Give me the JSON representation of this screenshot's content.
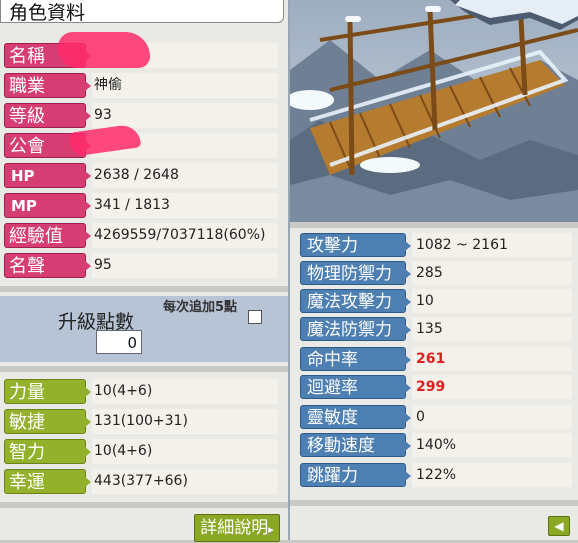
{
  "window": {
    "title": "角色資料"
  },
  "character": {
    "rows": [
      {
        "label": "名稱",
        "value": ""
      },
      {
        "label": "職業",
        "value": "神偷"
      },
      {
        "label": "等級",
        "value": "93"
      },
      {
        "label": "公會",
        "value": ""
      },
      {
        "label": "HP",
        "value": "2638 / 2648"
      },
      {
        "label": "MP",
        "value": "341 / 1813"
      },
      {
        "label": "經驗值",
        "value": "4269559/7037118(60%)"
      },
      {
        "label": "名聲",
        "value": "95"
      }
    ]
  },
  "ability_points": {
    "title": "升級點數",
    "value": "0",
    "auto_label": "每次追加5點",
    "auto_checked": false
  },
  "base_stats": [
    {
      "label": "力量",
      "value": "10(4+6)"
    },
    {
      "label": "敏捷",
      "value": "131(100+31)"
    },
    {
      "label": "智力",
      "value": "10(4+6)"
    },
    {
      "label": "幸運",
      "value": "443(377+66)"
    }
  ],
  "combat_stats": [
    {
      "label": "攻擊力",
      "value": "1082 ~ 2161",
      "highlight": false
    },
    {
      "label": "物理防禦力",
      "value": "285",
      "highlight": false
    },
    {
      "label": "魔法攻擊力",
      "value": "10",
      "highlight": false
    },
    {
      "label": "魔法防禦力",
      "value": "135",
      "highlight": false
    },
    {
      "label": "命中率",
      "value": "261",
      "highlight": true
    },
    {
      "label": "迴避率",
      "value": "299",
      "highlight": true
    },
    {
      "label": "靈敏度",
      "value": "0",
      "highlight": false
    },
    {
      "label": "移動速度",
      "value": "140%",
      "highlight": false
    },
    {
      "label": "跳躍力",
      "value": "122%",
      "highlight": false
    }
  ],
  "buttons": {
    "detail": "詳細說明",
    "detail_arrow": "▸",
    "back_icon": "arrow-left-icon",
    "back_glyph": "◀"
  },
  "colors": {
    "pink_label": "#d63d73",
    "green_label": "#93b12a",
    "blue_label": "#4d7fb3",
    "highlight_value": "#e02020"
  }
}
